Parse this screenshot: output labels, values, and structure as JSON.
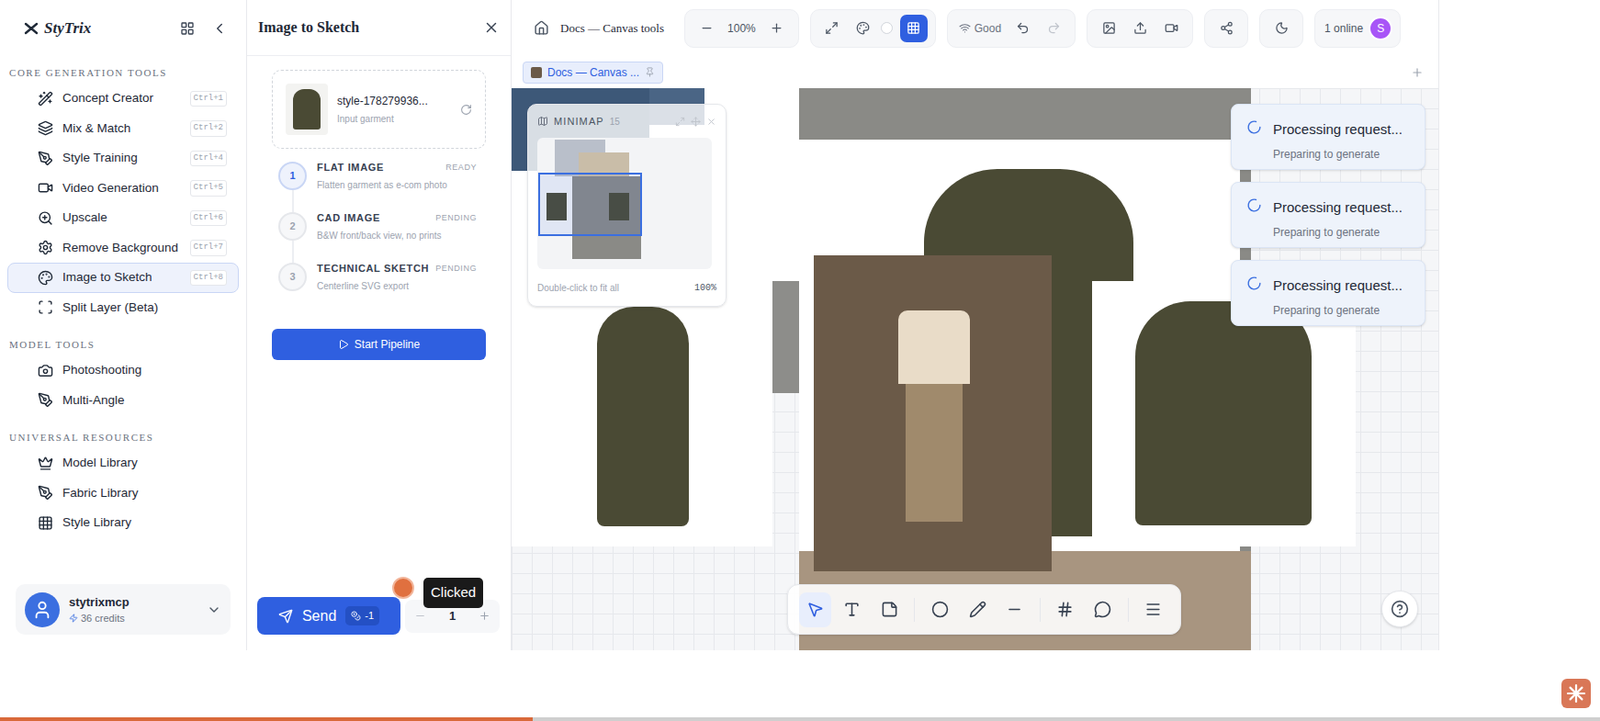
{
  "sidebar": {
    "logo": "StyTrix",
    "sections": [
      {
        "title": "CORE GENERATION TOOLS",
        "items": [
          {
            "label": "Concept Creator",
            "shortcut": "Ctrl+1",
            "selected": false
          },
          {
            "label": "Mix & Match",
            "shortcut": "Ctrl+2",
            "selected": false
          },
          {
            "label": "Style Training",
            "shortcut": "Ctrl+4",
            "selected": false
          },
          {
            "label": "Video Generation",
            "shortcut": "Ctrl+5",
            "selected": false
          },
          {
            "label": "Upscale",
            "shortcut": "Ctrl+6",
            "selected": false
          },
          {
            "label": "Remove Background",
            "shortcut": "Ctrl+7",
            "selected": false
          },
          {
            "label": "Image to Sketch",
            "shortcut": "Ctrl+8",
            "selected": true
          },
          {
            "label": "Split Layer (Beta)",
            "shortcut": "",
            "selected": false
          }
        ]
      },
      {
        "title": "MODEL TOOLS",
        "items": [
          {
            "label": "Photoshooting",
            "shortcut": "",
            "selected": false
          },
          {
            "label": "Multi-Angle",
            "shortcut": "",
            "selected": false
          }
        ]
      },
      {
        "title": "UNIVERSAL RESOURCES",
        "items": [
          {
            "label": "Model Library",
            "shortcut": "",
            "selected": false
          },
          {
            "label": "Fabric Library",
            "shortcut": "",
            "selected": false
          },
          {
            "label": "Style Library",
            "shortcut": "",
            "selected": false
          }
        ]
      }
    ],
    "user": {
      "name": "stytrixmcp",
      "credits": "36 credits"
    }
  },
  "panel": {
    "title": "Image to Sketch",
    "input": {
      "filename": "style-178279936...",
      "caption": "Input garment"
    },
    "steps": [
      {
        "number": "1",
        "title": "FLAT IMAGE",
        "status": "READY",
        "description": "Flatten garment as e-com photo",
        "active": true
      },
      {
        "number": "2",
        "title": "CAD IMAGE",
        "status": "PENDING",
        "description": "B&W front/back view, no prints",
        "active": false
      },
      {
        "number": "3",
        "title": "TECHNICAL SKETCH",
        "status": "PENDING",
        "description": "Centerline SVG export",
        "active": false
      }
    ],
    "start_button": "Start Pipeline",
    "send": {
      "label": "Send",
      "cost": "-1"
    },
    "quantity": "1",
    "click_marker": "Clicked"
  },
  "topbar": {
    "document": "Docs — Canvas tools",
    "zoom": "100%",
    "network": "Good",
    "online": "1 online",
    "avatar": "S",
    "grid_active": true
  },
  "tabs": [
    {
      "label": "Docs — Canvas ...",
      "selected": true
    }
  ],
  "minimap": {
    "title": "MINIMAP",
    "count": "15",
    "hint": "Double-click to fit all",
    "zoom": "100%"
  },
  "toasts": [
    {
      "title": "Processing request...",
      "subtitle": "Preparing to generate"
    },
    {
      "title": "Processing request...",
      "subtitle": "Preparing to generate"
    },
    {
      "title": "Processing request...",
      "subtitle": "Preparing to generate"
    }
  ],
  "toolbar": {
    "groups": [
      [
        {
          "kind": "select",
          "selected": true
        },
        {
          "kind": "text",
          "selected": false
        },
        {
          "kind": "note",
          "selected": false
        }
      ],
      [
        {
          "kind": "circle",
          "selected": false
        },
        {
          "kind": "pen",
          "selected": false
        },
        {
          "kind": "line",
          "selected": false
        }
      ],
      [
        {
          "kind": "frame",
          "selected": false
        },
        {
          "kind": "comment",
          "selected": false
        }
      ],
      [
        {
          "kind": "menu",
          "selected": false
        }
      ]
    ]
  },
  "progress": {
    "level": 0.333
  }
}
